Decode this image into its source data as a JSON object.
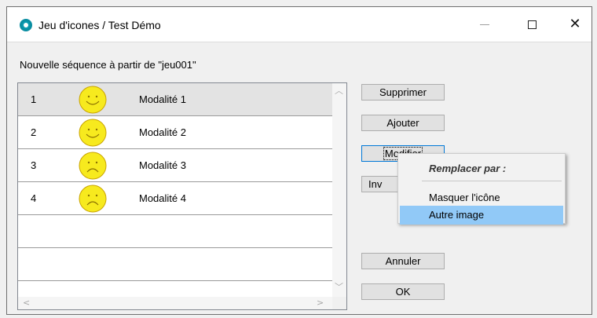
{
  "window": {
    "title": "Jeu d'icones / Test Démo",
    "close_glyph": "✕"
  },
  "subtitle": "Nouvelle séquence à partir de \"jeu001\"",
  "rows": [
    {
      "num": "1",
      "icon": "happy-smiley",
      "label": "Modalité 1"
    },
    {
      "num": "2",
      "icon": "happy-smiley",
      "label": "Modalité 2"
    },
    {
      "num": "3",
      "icon": "sad-smiley",
      "label": "Modalité 3"
    },
    {
      "num": "4",
      "icon": "sad-smiley",
      "label": "Modalité 4"
    }
  ],
  "buttons": {
    "supprimer": "Supprimer",
    "ajouter": "Ajouter",
    "modifier": "Modifier",
    "inverser_partial": "Inv",
    "annuler": "Annuler",
    "ok": "OK"
  },
  "context_menu": {
    "header": "Remplacer par :",
    "items": [
      "Masquer l'icône",
      "Autre image"
    ],
    "highlighted_index": 1
  },
  "scroll_arrows": {
    "up": "︿",
    "down": "﹀",
    "left": "<",
    "right": ">"
  },
  "colors": {
    "smiley_fill": "#f7ea1e",
    "menu_highlight": "#91c9f7",
    "selected_row": "#e3e3e3"
  }
}
